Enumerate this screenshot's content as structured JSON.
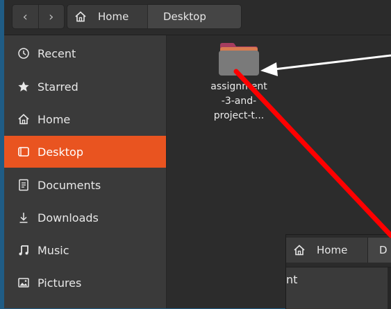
{
  "header": {
    "nav_back": "‹",
    "nav_forward": "›",
    "path": [
      {
        "label": "Home",
        "icon": "home-icon"
      },
      {
        "label": "Desktop",
        "icon": "chevron-down-icon"
      }
    ]
  },
  "sidebar": {
    "items": [
      {
        "label": "Recent",
        "icon": "clock-icon"
      },
      {
        "label": "Starred",
        "icon": "star-icon"
      },
      {
        "label": "Home",
        "icon": "home-icon"
      },
      {
        "label": "Desktop",
        "icon": "desktop-icon",
        "active": true
      },
      {
        "label": "Documents",
        "icon": "document-icon"
      },
      {
        "label": "Downloads",
        "icon": "download-icon"
      },
      {
        "label": "Music",
        "icon": "music-icon"
      },
      {
        "label": "Pictures",
        "icon": "picture-icon"
      }
    ]
  },
  "content": {
    "file": {
      "name_lines": [
        "assignment",
        "-3-and-",
        "project-t..."
      ],
      "icon": "folder-icon"
    }
  },
  "second_window": {
    "home_label": "Home",
    "desktop_label_partial": "D",
    "sidebar_partial": "nt"
  },
  "colors": {
    "accent": "#e95420",
    "annotation_red": "#ff0000",
    "annotation_white": "#ffffff"
  }
}
